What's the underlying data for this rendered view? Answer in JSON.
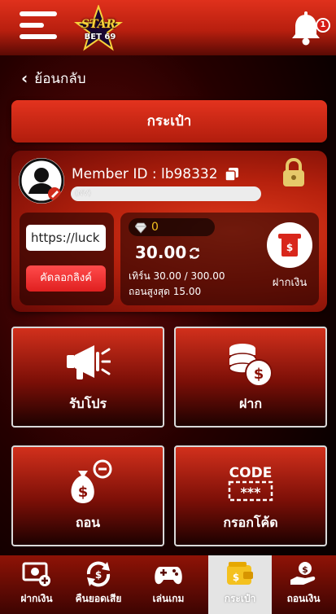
{
  "header": {
    "logo_top": "STAR",
    "logo_bottom": "BET 69",
    "notification_count": "1"
  },
  "back_label": "ย้อนกลับ",
  "page_title": "กระเป๋า",
  "wallet": {
    "member_id_label": "Member ID : lb98332",
    "level_label": "(NV)",
    "referral_link": "https://luck",
    "copy_link_label": "คัดลอกลิงค์",
    "gems": "0",
    "balance": "30.00",
    "turnover": "เทิร์น 30.00 / 300.00",
    "max_withdraw": "ถอนสูงสุด 15.00",
    "deposit_label": "ฝากเงิน"
  },
  "tiles": [
    {
      "label": "รับโปร",
      "icon": "megaphone-icon"
    },
    {
      "label": "ฝาก",
      "icon": "coins-icon"
    },
    {
      "label": "ถอน",
      "icon": "money-bag-icon"
    },
    {
      "label": "กรอกโค้ด",
      "icon": "code-icon",
      "icon_text": "CODE",
      "icon_subtext": "***"
    }
  ],
  "bottom_nav": [
    {
      "label": "ฝากเงิน",
      "icon": "deposit-icon"
    },
    {
      "label": "คืนยอดเสีย",
      "icon": "cashback-icon"
    },
    {
      "label": "เล่นเกม",
      "icon": "gamepad-icon"
    },
    {
      "label": "กระเป๋า",
      "icon": "wallet-icon",
      "active": true
    },
    {
      "label": "ถอนเงิน",
      "icon": "withdraw-icon"
    }
  ],
  "colors": {
    "primary_red": "#d0301c",
    "dark_red": "#3d0402",
    "gold": "#f4c11f",
    "button_red": "#e02020"
  }
}
